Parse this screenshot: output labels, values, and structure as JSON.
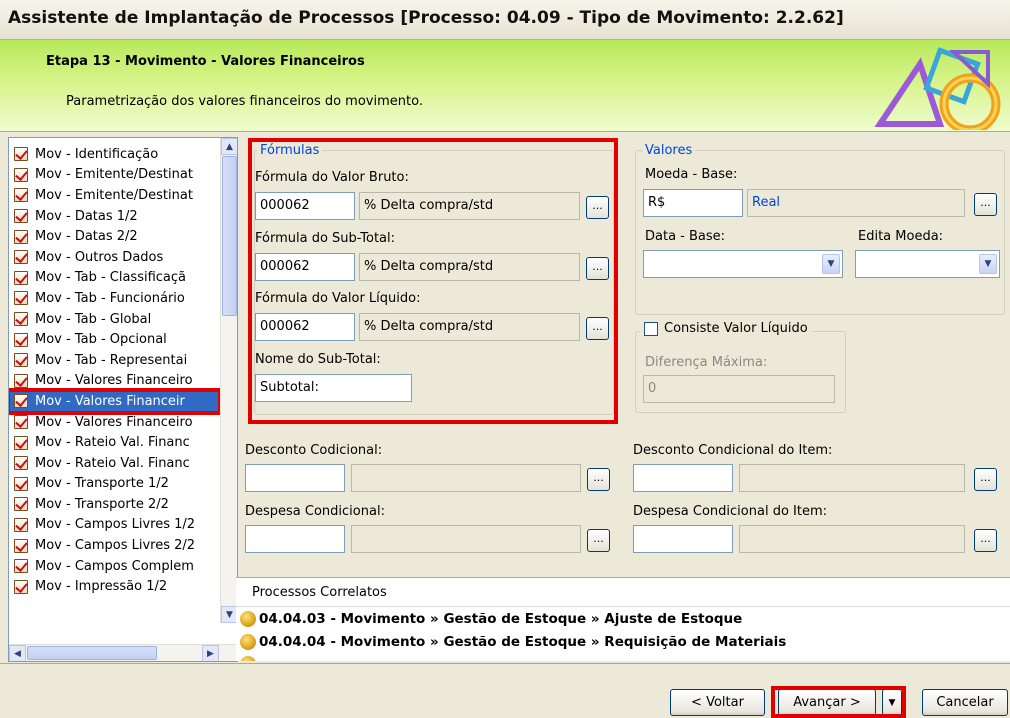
{
  "window": {
    "title": "Assistente de Implantação de Processos [Processo: 04.09 - Tipo de Movimento: 2.2.62]"
  },
  "step": {
    "title": "Etapa 13 - Movimento - Valores Financeiros",
    "description": "Parametrização dos valores financeiros do movimento."
  },
  "sidebar": {
    "items": [
      {
        "label": "Mov - Identificação"
      },
      {
        "label": "Mov - Emitente/Destinat"
      },
      {
        "label": "Mov - Emitente/Destinat"
      },
      {
        "label": "Mov - Datas 1/2"
      },
      {
        "label": "Mov - Datas 2/2"
      },
      {
        "label": "Mov - Outros Dados"
      },
      {
        "label": "Mov - Tab - Classificaçã"
      },
      {
        "label": "Mov - Tab - Funcionário"
      },
      {
        "label": "Mov - Tab - Global"
      },
      {
        "label": "Mov - Tab - Opcional"
      },
      {
        "label": "Mov - Tab - Representai"
      },
      {
        "label": "Mov - Valores Financeiro"
      },
      {
        "label": "Mov - Valores Financeir"
      },
      {
        "label": "Mov - Valores Financeiro"
      },
      {
        "label": "Mov - Rateio Val. Financ"
      },
      {
        "label": "Mov - Rateio Val. Financ"
      },
      {
        "label": "Mov - Transporte 1/2"
      },
      {
        "label": "Mov - Transporte 2/2"
      },
      {
        "label": "Mov - Campos Livres 1/2"
      },
      {
        "label": "Mov - Campos Livres 2/2"
      },
      {
        "label": "Mov - Campos Complem"
      },
      {
        "label": "Mov - Impressão 1/2"
      }
    ],
    "selected_index": 12
  },
  "formulas": {
    "legend": "Fórmulas",
    "bruto_label": "Fórmula do Valor Bruto:",
    "bruto_code": "000062",
    "bruto_desc": "% Delta compra/std",
    "subtotal_label": "Fórmula do Sub-Total:",
    "subtotal_code": "000062",
    "subtotal_desc": "% Delta compra/std",
    "liquido_label": "Fórmula do Valor Líquido:",
    "liquido_code": "000062",
    "liquido_desc": "% Delta compra/std",
    "nome_subtotal_label": "Nome do Sub-Total:",
    "nome_subtotal_value": "Subtotal:"
  },
  "valores": {
    "legend": "Valores",
    "moeda_label": "Moeda - Base:",
    "moeda_code": "R$",
    "moeda_desc": "Real",
    "data_base_label": "Data - Base:",
    "edita_moeda_label": "Edita Moeda:"
  },
  "consiste": {
    "checkbox_label": "Consiste Valor Líquido",
    "checked": false,
    "diferenca_label": "Diferença Máxima:",
    "diferenca_value": "0"
  },
  "descontos": {
    "desconto_condicional_label": "Desconto Codicional:",
    "despesa_condicional_label": "Despesa Condicional:",
    "desconto_item_label": "Desconto Condicional do Item:",
    "despesa_item_label": "Despesa Condicional do Item:"
  },
  "lookup_label": "...",
  "correlated": {
    "title": "Processos Correlatos",
    "items": [
      "04.04.03 - Movimento » Gestão de Estoque » Ajuste de Estoque",
      "04.04.04 - Movimento » Gestão de Estoque » Requisição de Materiais"
    ]
  },
  "footer": {
    "back_label": "Voltar",
    "next_label": "Avançar",
    "cancel_label": "Cancelar"
  },
  "colors": {
    "highlight": "#e00000",
    "selection": "#316ac5",
    "legend": "#0046d5",
    "banner": "#c8ef70"
  }
}
